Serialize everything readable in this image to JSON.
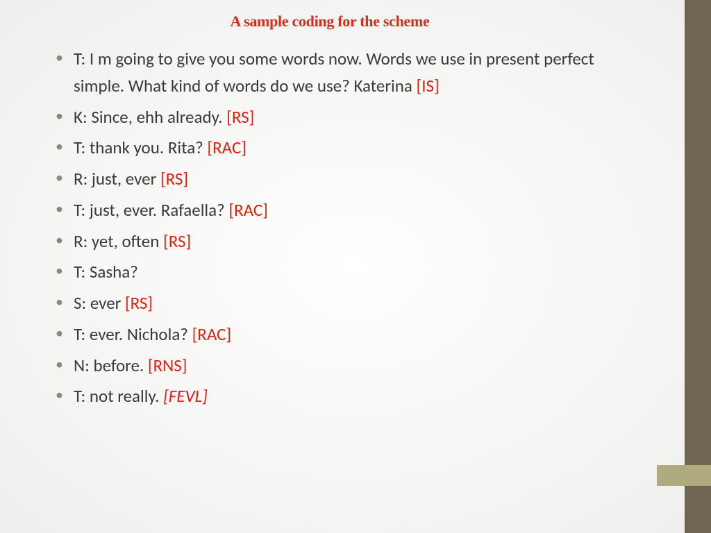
{
  "title": "A sample coding for the scheme",
  "items": [
    {
      "text": "T: I m going to give you some words now.  Words we use in present perfect simple. What kind of words do we use? Katerina ",
      "code": "[IS]",
      "italic": false
    },
    {
      "text": "K: Since, ehh already. ",
      "code": "[RS]",
      "italic": false
    },
    {
      "text": "T: thank you. Rita? ",
      "code": "[RAC]",
      "italic": false
    },
    {
      "text": "R: just, ever ",
      "code": "[RS]",
      "italic": false
    },
    {
      "text": "T: just, ever. Rafaella? ",
      "code": "[RAC]",
      "italic": false
    },
    {
      "text": "R: yet, often ",
      "code": "[RS]",
      "italic": false
    },
    {
      "text": "T: Sasha?",
      "code": "",
      "italic": false
    },
    {
      "text": "S: ever ",
      "code": "[RS]",
      "italic": false
    },
    {
      "text": "T: ever. Nichola? ",
      "code": "[RAC]",
      "italic": false
    },
    {
      "text": "N: before. ",
      "code": "[RNS]",
      "italic": false
    },
    {
      "text": "T: not really. ",
      "code": "[FEVL]",
      "italic": true
    }
  ]
}
